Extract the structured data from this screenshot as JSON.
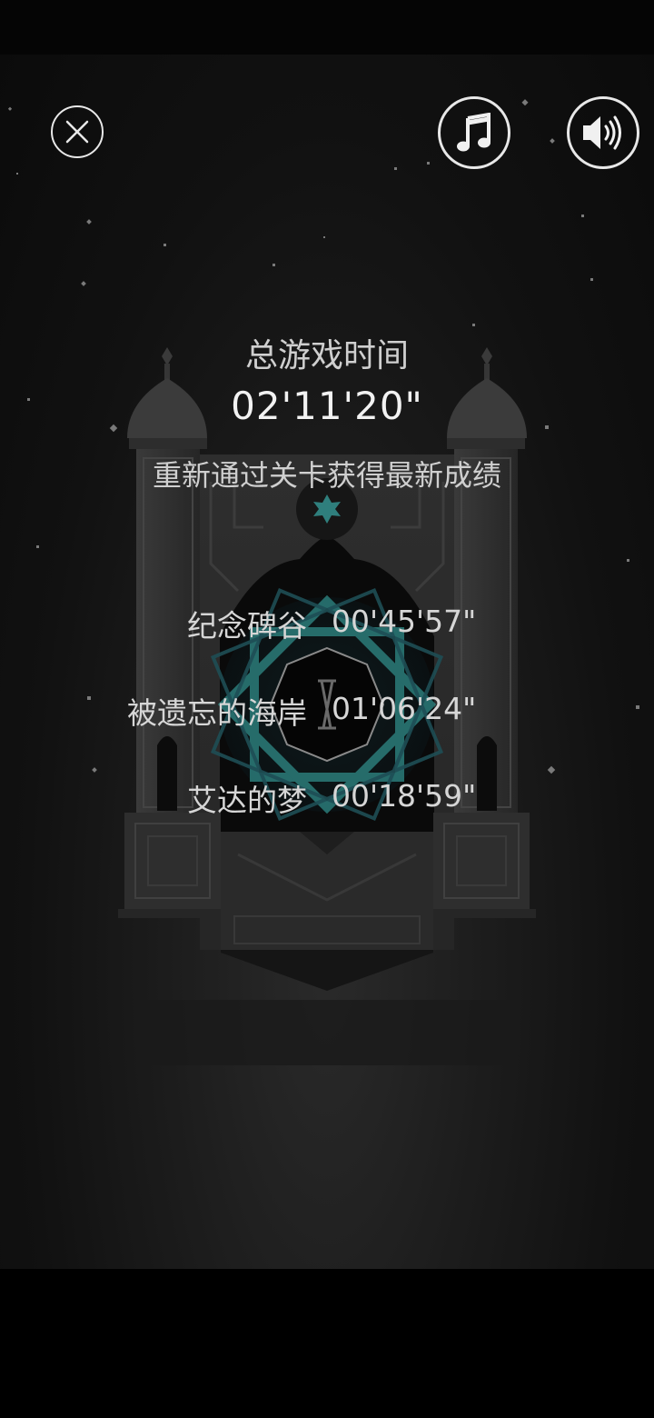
{
  "summary": {
    "total_label": "总游戏时间",
    "total_time": "02'11'20\"",
    "replay_hint": "重新通过关卡获得最新成绩"
  },
  "levels": [
    {
      "name": "纪念碑谷",
      "time": "00'45'57\""
    },
    {
      "name": "被遗忘的海岸",
      "time": "01'06'24\""
    },
    {
      "name": "艾达的梦",
      "time": "00'18'59\""
    }
  ],
  "icons": {
    "close": "close-icon",
    "music": "music-note-icon",
    "sound": "speaker-icon"
  },
  "colors": {
    "background": "#111111",
    "text": "#d9d9d9",
    "accent": "#2f8a87"
  }
}
